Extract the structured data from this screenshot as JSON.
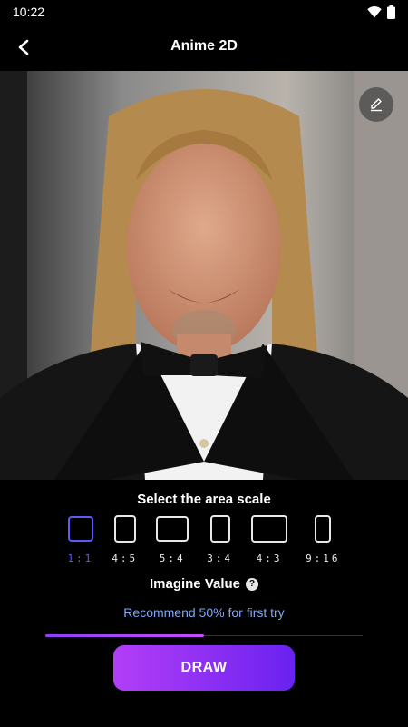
{
  "status_bar": {
    "time": "10:22"
  },
  "app_bar": {
    "title": "Anime 2D"
  },
  "scale": {
    "heading": "Select the area scale",
    "options": [
      {
        "label": "1:1",
        "selected": true
      },
      {
        "label": "4:5",
        "selected": false
      },
      {
        "label": "5:4",
        "selected": false
      },
      {
        "label": "3:4",
        "selected": false
      },
      {
        "label": "4:3",
        "selected": false
      },
      {
        "label": "9:16",
        "selected": false
      }
    ]
  },
  "imagine": {
    "heading": "Imagine Value",
    "hint": "Recommend 50% for first try",
    "value": 0.5
  },
  "draw_label": "DRAW",
  "colors": {
    "accent": "#5b5cf6",
    "hint": "#7ea8f5",
    "button_start": "#b33ef7",
    "button_end": "#6a22f0"
  }
}
